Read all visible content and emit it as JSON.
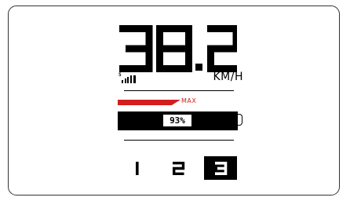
{
  "speed": {
    "value": "38.2",
    "unit": "KM/H"
  },
  "signal": {
    "label": "5",
    "level": 4,
    "max_level": 4
  },
  "power": {
    "label": "MAX",
    "color": "#d41e1e"
  },
  "battery": {
    "percent": 93,
    "label": "93%"
  },
  "assist": {
    "levels": [
      "1",
      "2",
      "3"
    ],
    "selected": "3"
  },
  "colors": {
    "foreground": "#000000",
    "background": "#ffffff",
    "accent": "#d41e1e"
  }
}
